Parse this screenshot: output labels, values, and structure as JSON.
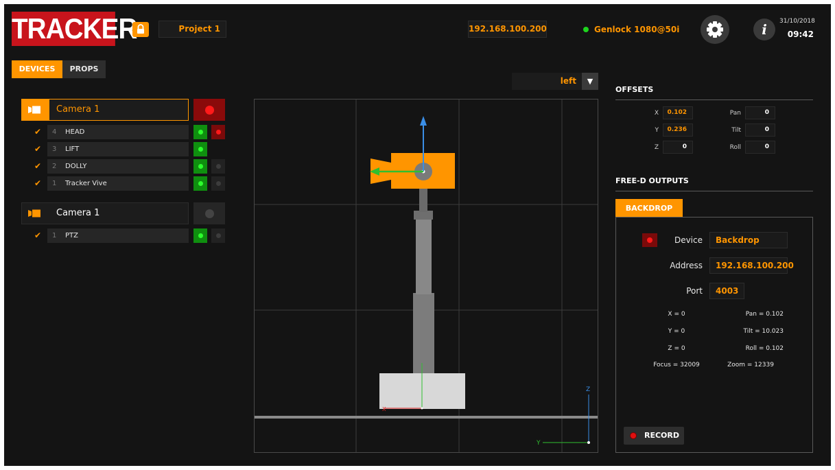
{
  "header": {
    "logo": "TRACKER",
    "project": "Project 1",
    "ip": "192.168.100.200",
    "genlock": "Genlock 1080@50i",
    "date": "31/10/2018",
    "time": "09:42"
  },
  "tabs": [
    {
      "label": "DEVICES",
      "active": true
    },
    {
      "label": "PROPS",
      "active": false
    }
  ],
  "cameras": [
    {
      "name": "Camera 1",
      "selected": true,
      "recording": true,
      "devices": [
        {
          "num": "4",
          "label": "HEAD",
          "checked": true,
          "status": "green",
          "rec": "red"
        },
        {
          "num": "3",
          "label": "LIFT",
          "checked": true,
          "status": "green",
          "rec": "none"
        },
        {
          "num": "2",
          "label": "DOLLY",
          "checked": true,
          "status": "green",
          "rec": "grey"
        },
        {
          "num": "1",
          "label": "Tracker Vive",
          "checked": true,
          "status": "green",
          "rec": "grey"
        }
      ]
    },
    {
      "name": "Camera 1",
      "selected": false,
      "recording": false,
      "devices": [
        {
          "num": "1",
          "label": "PTZ",
          "checked": true,
          "status": "green",
          "rec": "grey"
        }
      ]
    }
  ],
  "viewport": {
    "view": "left",
    "axis_z": "Z",
    "axis_y": "Y",
    "axis_x": "X"
  },
  "offsets": {
    "title": "OFFSETS",
    "x_label": "X",
    "x": "0.102",
    "y_label": "Y",
    "y": "0.236",
    "z_label": "Z",
    "z": "0",
    "pan_label": "Pan",
    "pan": "0",
    "tilt_label": "Tilt",
    "tilt": "0",
    "roll_label": "Roll",
    "roll": "0"
  },
  "freed": {
    "title": "FREE-D OUTPUTS",
    "tab": "BACKDROP",
    "device_label": "Device",
    "device": "Backdrop",
    "address_label": "Address",
    "address": "192.168.100.200",
    "port_label": "Port",
    "port": "4003",
    "x": "X = 0",
    "pan": "Pan = 0.102",
    "y": "Y = 0",
    "tilt": "Tilt = 10.023",
    "z": "Z = 0",
    "roll": "Roll = 0.102",
    "focus": "Focus = 32009",
    "zoom": "Zoom = 12339",
    "record": "RECORD"
  },
  "colors": {
    "accent": "#ff9500",
    "logo": "#c8141c",
    "ok": "#1ed41e",
    "rec": "#e01010"
  }
}
